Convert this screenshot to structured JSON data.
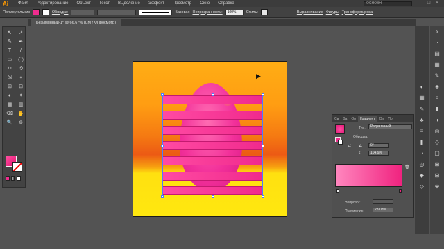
{
  "app": {
    "logo": "Ai",
    "menu": [
      "Файл",
      "Редактирование",
      "Объект",
      "Текст",
      "Выделение",
      "Эффект",
      "Просмотр",
      "Окно",
      "Справка"
    ],
    "workspace": "ОСНОВН",
    "window_controls": [
      "–",
      "□",
      "×"
    ]
  },
  "control_bar": {
    "selection_label": "Прямоугольник",
    "stroke_label": "Обводка:",
    "stroke_style": "Базовая",
    "opacity_label": "Непрозрачность:",
    "opacity_value": "100%",
    "style_label": "Стиль:",
    "align_label": "Выравнивание",
    "shape_label": "Фигуры",
    "transform_label": "Трансформирова"
  },
  "document": {
    "tab_title": "Безымянный-1* @ 66,67% (CMYK/Просмотр)"
  },
  "tools": [
    "↖",
    "↗",
    "✎",
    "✒",
    "T",
    "/",
    "▭",
    "◯",
    "✂",
    "⟲",
    "⇲",
    "⌖",
    "⊞",
    "⊟",
    "◐",
    "✦",
    "▦",
    "▥",
    "⌫",
    "✋",
    "🔍",
    "⊕"
  ],
  "gradient_panel": {
    "tabs": [
      "Св",
      "Ва",
      "Ор",
      "Градиент",
      "Оп",
      "Пр"
    ],
    "active_tab": "Градиент",
    "type_label": "Тип:",
    "type_value": "Радиальный",
    "stroke_label": "Обводка:",
    "angle_value": "0°",
    "aspect_value": "104,9%",
    "opacity_label": "Непрозр.:",
    "location_label": "Положение:",
    "location_value": "23,08%"
  },
  "colors": {
    "accent_pink": "#f02c8e",
    "artboard_top": "#ffad14",
    "artboard_bottom": "#ffe80f",
    "selection": "#4a7cff"
  },
  "dock_icons": [
    "color-icon",
    "swatch-icon",
    "brush-icon",
    "symbol-icon",
    "stroke-icon",
    "gradient-icon",
    "transparency-icon",
    "appearance-icon",
    "graphic-styles-icon",
    "layers-icon",
    "artboards-icon",
    "align-icon",
    "pathfinder-icon",
    "transform-icon"
  ]
}
